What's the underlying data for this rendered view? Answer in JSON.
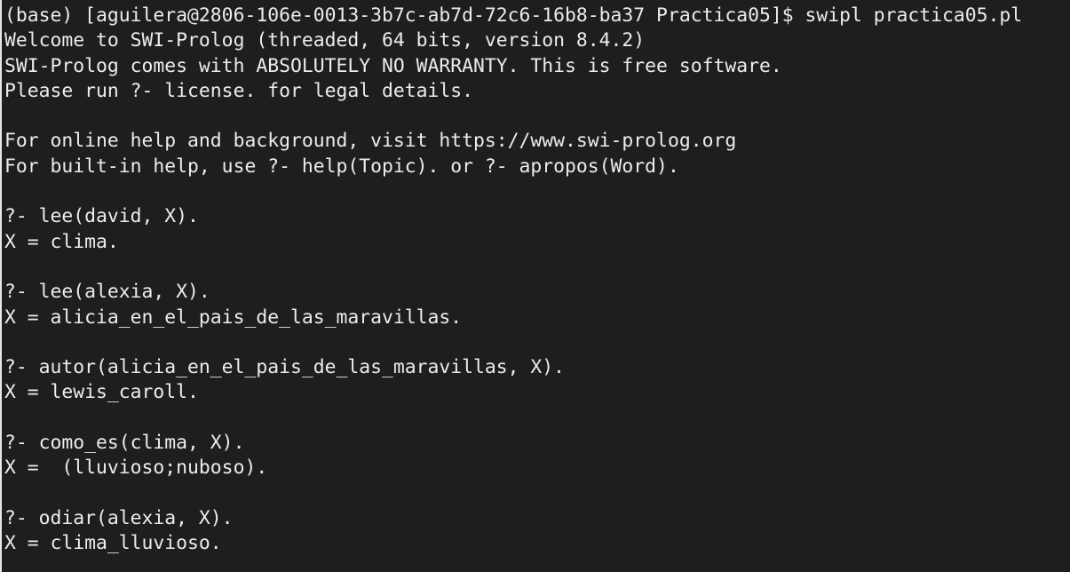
{
  "terminal": {
    "lines": [
      "(base) [aguilera@2806-106e-0013-3b7c-ab7d-72c6-16b8-ba37 Practica05]$ swipl practica05.pl",
      "Welcome to SWI-Prolog (threaded, 64 bits, version 8.4.2)",
      "SWI-Prolog comes with ABSOLUTELY NO WARRANTY. This is free software.",
      "Please run ?- license. for legal details.",
      "",
      "For online help and background, visit https://www.swi-prolog.org",
      "For built-in help, use ?- help(Topic). or ?- apropos(Word).",
      "",
      "?- lee(david, X).",
      "X = clima.",
      "",
      "?- lee(alexia, X).",
      "X = alicia_en_el_pais_de_las_maravillas.",
      "",
      "?- autor(alicia_en_el_pais_de_las_maravillas, X).",
      "X = lewis_caroll.",
      "",
      "?- como_es(clima, X).",
      "X =  (lluvioso;nuboso).",
      "",
      "?- odiar(alexia, X).",
      "X = clima_lluvioso."
    ]
  },
  "colors": {
    "background": "#1e1e1e",
    "foreground": "#ececec"
  }
}
